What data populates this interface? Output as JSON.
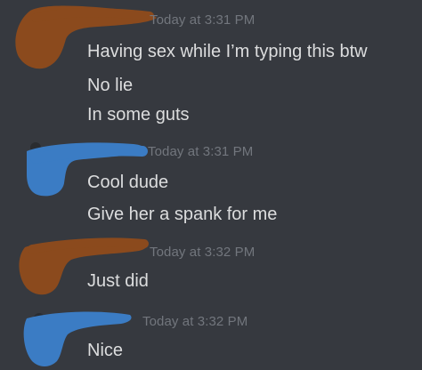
{
  "messages": [
    {
      "timestamp": "Today at 3:31 PM",
      "lines": [
        "Having sex while I’m typing this btw",
        "No lie",
        "In some guts"
      ],
      "redaction_color": "#8b4a1d"
    },
    {
      "timestamp": "Today at 3:31 PM",
      "lines": [
        "Cool dude",
        "Give her a spank for me"
      ],
      "redaction_color": "#3b7cc4"
    },
    {
      "timestamp": "Today at 3:32 PM",
      "lines": [
        "Just did"
      ],
      "redaction_color": "#8b4a1d"
    },
    {
      "timestamp": "Today at 3:32 PM",
      "lines": [
        "Nice"
      ],
      "redaction_color": "#3b7cc4"
    }
  ],
  "colors": {
    "background": "#36393f",
    "message_text": "#dcddde",
    "timestamp_text": "#72767d"
  }
}
